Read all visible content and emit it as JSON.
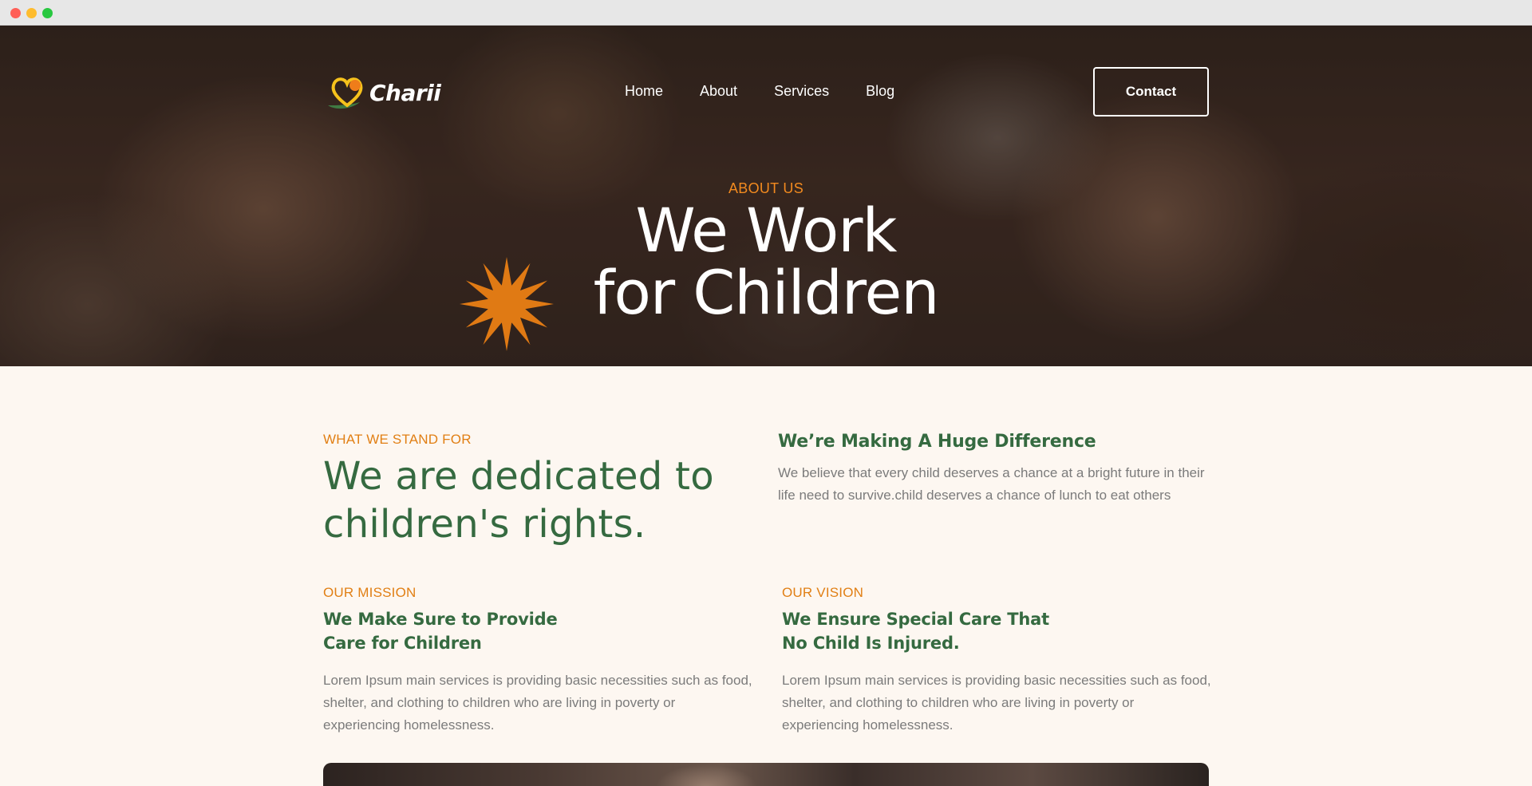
{
  "nav": {
    "logo_text": "Charii",
    "links": [
      "Home",
      "About",
      "Services",
      "Blog"
    ],
    "contact_label": "Contact"
  },
  "hero": {
    "eyebrow": "ABOUT US",
    "title_line1": "We Work",
    "title_line2": "for Children"
  },
  "stand": {
    "eyebrow": "WHAT WE STAND FOR",
    "title_line1": "We are dedicated to",
    "title_line2": "children's rights."
  },
  "difference": {
    "title": "We’re Making A Huge Difference",
    "text": "We believe that every child deserves a chance at a bright future in their life need to survive.child deserves a chance of lunch to eat others"
  },
  "mission": {
    "eyebrow": "OUR MISSION",
    "title_line1": "We Make Sure to Provide",
    "title_line2": "Care for Children",
    "text": "Lorem Ipsum main services is providing basic necessities such as food, shelter, and clothing to children who are living in poverty or experiencing homelessness."
  },
  "vision": {
    "eyebrow": "OUR VISION",
    "title_line1": "We Ensure Special Care That",
    "title_line2": "No Child Is Injured.",
    "text": "Lorem Ipsum main services is providing basic necessities such as food, shelter, and clothing to children who are living in poverty or experiencing homelessness."
  },
  "colors": {
    "accent_orange": "#e17f14",
    "brand_green": "#356a40",
    "page_bg": "#fdf7f1"
  },
  "icons": {
    "logo": "heart-leaf-icon",
    "decoration": "starburst-icon"
  }
}
